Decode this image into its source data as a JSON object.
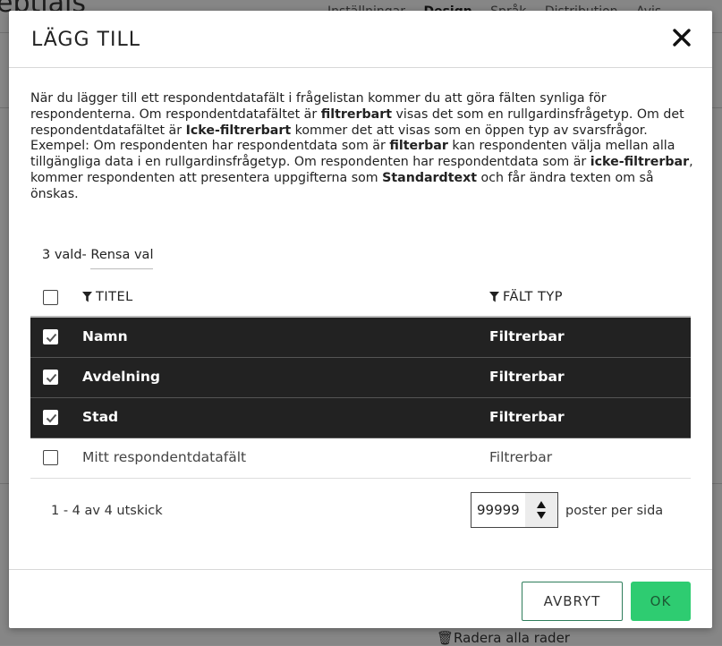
{
  "background": {
    "title_fragment": "eptials",
    "tabs": [
      "Inställningar",
      "Design",
      "Språk",
      "Distribution",
      "Avis"
    ],
    "bottom_action": "Radera alla rader"
  },
  "modal": {
    "title": "LÄGG TILL",
    "description": [
      {
        "t": "När du lägger till ett respondentdatafält i frågelistan kommer du att göra fälten synliga för respondenterna. Om respondentdatafältet är ",
        "b": false
      },
      {
        "t": "filtrerbart",
        "b": true
      },
      {
        "t": " visas det som en rullgardinsfrågetyp. Om det respondentdatafältet är ",
        "b": false
      },
      {
        "t": "Icke-filtrerbart",
        "b": true
      },
      {
        "t": " kommer det att visas som en öppen typ av svarsfrågor.",
        "b": false
      },
      {
        "t": "\n",
        "b": false
      },
      {
        "t": "Exempel: Om respondenten har respondentdata som är ",
        "b": false
      },
      {
        "t": "filterbar",
        "b": true
      },
      {
        "t": " kan respondenten välja mellan alla tillgängliga data i en rullgardinsfrågetyp. Om respondenten har respondentdata som är ",
        "b": false
      },
      {
        "t": "icke-filtrerbar",
        "b": true
      },
      {
        "t": ", kommer respondenten att presentera uppgifterna som ",
        "b": false
      },
      {
        "t": "Standardtext",
        "b": true
      },
      {
        "t": " och får ändra texten om så önskas.",
        "b": false
      }
    ],
    "selection": {
      "count_text": "3 vald-",
      "clear_label": "Rensa val"
    },
    "table": {
      "headers": {
        "title": "TITEL",
        "type": "FÄLT TYP"
      },
      "rows": [
        {
          "title": "Namn",
          "type": "Filtrerbar",
          "selected": true
        },
        {
          "title": "Avdelning",
          "type": "Filtrerbar",
          "selected": true
        },
        {
          "title": "Stad",
          "type": "Filtrerbar",
          "selected": true
        },
        {
          "title": "Mitt respondentdatafält",
          "type": "Filtrerbar",
          "selected": false
        }
      ]
    },
    "pager": {
      "info": "1 - 4 av 4 utskick",
      "per_page_value": "99999",
      "per_page_label": "poster per sida"
    },
    "buttons": {
      "cancel": "AVBRYT",
      "ok": "OK"
    }
  },
  "colors": {
    "selected_row": "#222222",
    "ok_button": "#2ecc71",
    "cancel_border": "#2e7d5b"
  },
  "icons": {
    "close": "close-icon",
    "filter": "filter-icon",
    "check": "checkmark-icon"
  }
}
